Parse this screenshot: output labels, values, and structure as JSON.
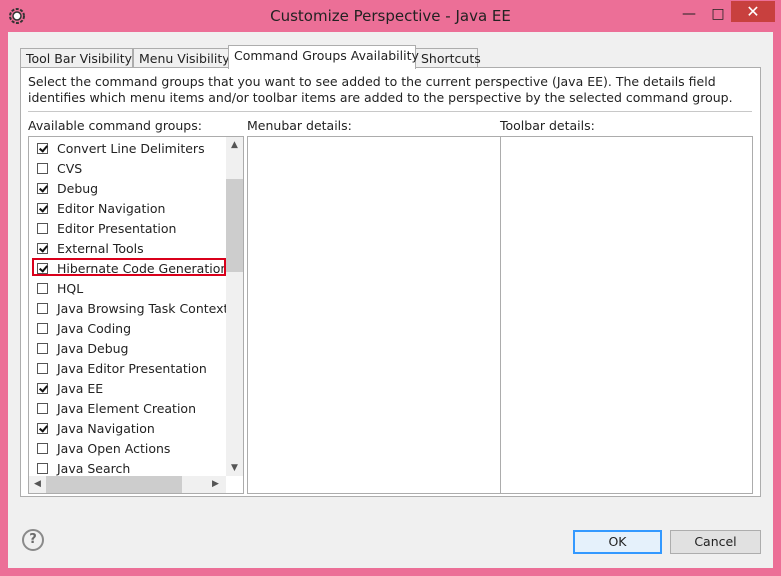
{
  "window": {
    "title": "Customize Perspective - Java EE"
  },
  "tabs": [
    {
      "label": "Tool Bar Visibility"
    },
    {
      "label": "Menu Visibility"
    },
    {
      "label": "Command Groups Availability"
    },
    {
      "label": "Shortcuts"
    }
  ],
  "active_tab": "Command Groups Availability",
  "description": "Select the command groups that you want to see added to the current perspective (Java EE).  The details field identifies which menu items and/or toolbar items are added to the perspective by the selected command group.",
  "labels": {
    "available": "Available command groups:",
    "menubar": "Menubar details:",
    "toolbar": "Toolbar details:"
  },
  "command_groups": [
    {
      "label": "Convert Line Delimiters",
      "checked": true
    },
    {
      "label": "CVS",
      "checked": false
    },
    {
      "label": "Debug",
      "checked": true
    },
    {
      "label": "Editor Navigation",
      "checked": true
    },
    {
      "label": "Editor Presentation",
      "checked": false
    },
    {
      "label": "External Tools",
      "checked": true
    },
    {
      "label": "Hibernate Code Generation",
      "checked": true
    },
    {
      "label": "HQL",
      "checked": false
    },
    {
      "label": "Java Browsing Task Context",
      "checked": false
    },
    {
      "label": "Java Coding",
      "checked": false
    },
    {
      "label": "Java Debug",
      "checked": false
    },
    {
      "label": "Java Editor Presentation",
      "checked": false
    },
    {
      "label": "Java EE",
      "checked": true
    },
    {
      "label": "Java Element Creation",
      "checked": false
    },
    {
      "label": "Java Navigation",
      "checked": true
    },
    {
      "label": "Java Open Actions",
      "checked": false
    },
    {
      "label": "Java Search",
      "checked": false
    }
  ],
  "highlighted_item": "Hibernate Code Generation",
  "buttons": {
    "ok": "OK",
    "cancel": "Cancel",
    "help": "?"
  }
}
